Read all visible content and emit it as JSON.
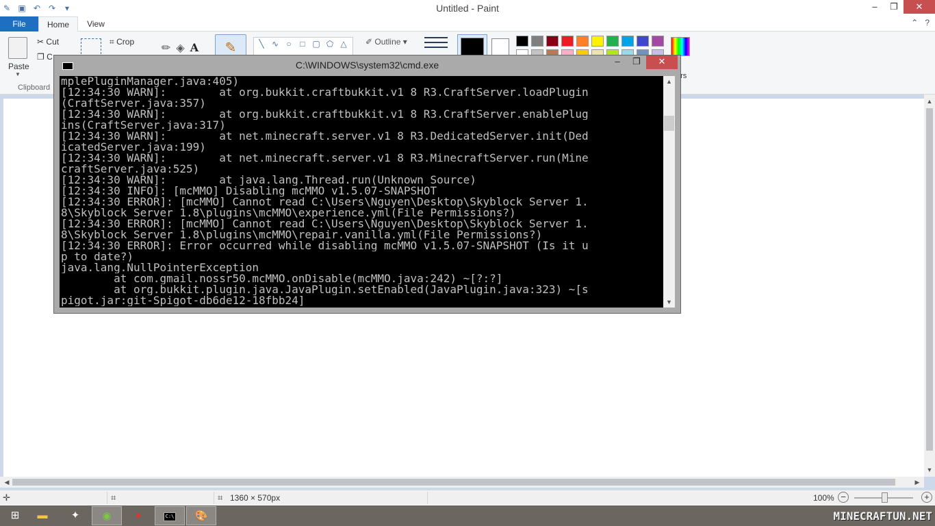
{
  "paint": {
    "title": "Untitled - Paint",
    "tabs": {
      "file": "File",
      "home": "Home",
      "view": "View"
    },
    "clipboard": {
      "paste": "Paste",
      "cut": "Cut",
      "copy": "C",
      "group_label": "Clipboard"
    },
    "image": {
      "crop": "Crop"
    },
    "shapes": {
      "outline": "Outline"
    },
    "colors": {
      "color1": "#000000",
      "color2": "#ffffff",
      "palette": [
        "#000000",
        "#7f7f7f",
        "#880015",
        "#ed1c24",
        "#ff7f27",
        "#fff200",
        "#22b14c",
        "#00a2e8",
        "#3f48cc",
        "#a349a4",
        "#ffffff",
        "#c3c3c3",
        "#b97a57",
        "#ffaec9",
        "#ffc90e",
        "#efe4b0",
        "#b5e61d",
        "#99d9ea",
        "#7092be",
        "#c8bfe7"
      ],
      "edit_label_line1": "it",
      "edit_label_line2": "ors"
    },
    "status": {
      "dimensions": "1360 × 570px",
      "zoom": "100%"
    }
  },
  "cmd": {
    "title": "C:\\WINDOWS\\system32\\cmd.exe",
    "lines": [
      "mplePluginManager.java:405)",
      "[12:34:30 WARN]:        at org.bukkit.craftbukkit.v1_8_R3.CraftServer.loadPlugin",
      "(CraftServer.java:357)",
      "[12:34:30 WARN]:        at org.bukkit.craftbukkit.v1_8_R3.CraftServer.enablePlug",
      "ins(CraftServer.java:317)",
      "[12:34:30 WARN]:        at net.minecraft.server.v1_8_R3.DedicatedServer.init(Ded",
      "icatedServer.java:199)",
      "[12:34:30 WARN]:        at net.minecraft.server.v1_8_R3.MinecraftServer.run(Mine",
      "craftServer.java:525)",
      "[12:34:30 WARN]:        at java.lang.Thread.run(Unknown Source)",
      "[12:34:30 INFO]: [mcMMO] Disabling mcMMO v1.5.07-SNAPSHOT",
      "[12:34:30 ERROR]: [mcMMO] Cannot read C:\\Users\\Nguyen\\Desktop\\Skyblock Server 1.",
      "8\\Skyblock Server 1.8\\plugins\\mcMMO\\experience.yml(File Permissions?)",
      "[12:34:30 ERROR]: [mcMMO] Cannot read C:\\Users\\Nguyen\\Desktop\\Skyblock Server 1.",
      "8\\Skyblock Server 1.8\\plugins\\mcMMO\\repair.vanilla.yml(File Permissions?)",
      "[12:34:30 ERROR]: Error occurred while disabling mcMMO v1.5.07-SNAPSHOT (Is it u",
      "p to date?)",
      "java.lang.NullPointerException",
      "        at com.gmail.nossr50.mcMMO.onDisable(mcMMO.java:242) ~[?:?]",
      "        at org.bukkit.plugin.java.JavaPlugin.setEnabled(JavaPlugin.java:323) ~[s",
      "pigot.jar:git-Spigot-db6de12-18fbb24]"
    ]
  },
  "taskbar": {
    "watermark": "MINECRAFTUN.NET",
    "cmd_icon_text": "C:\\"
  }
}
